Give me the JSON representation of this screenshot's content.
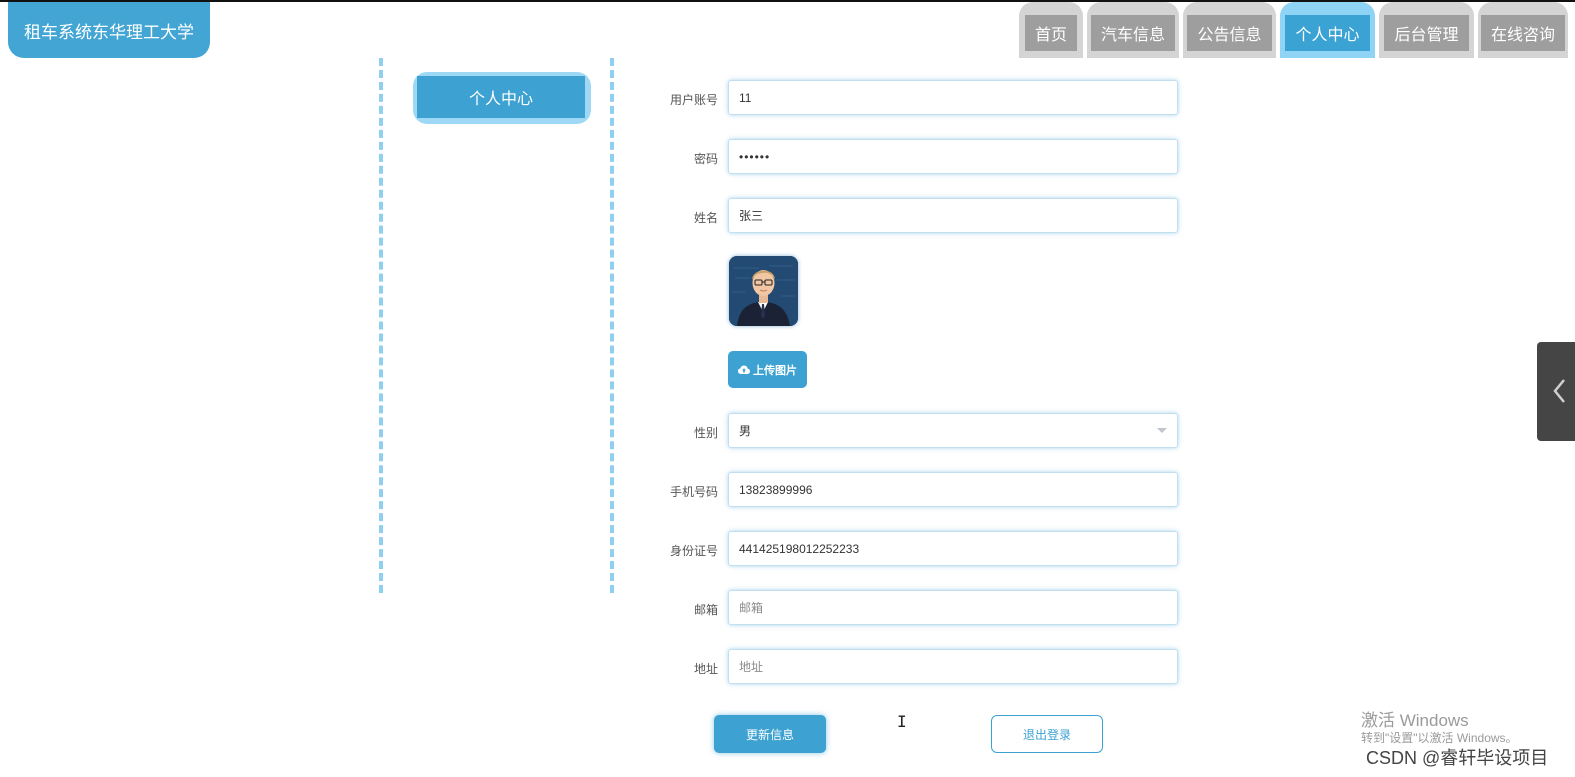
{
  "site": {
    "title": "租车系统东华理工大学"
  },
  "nav": {
    "items": [
      {
        "label": "首页",
        "active": false
      },
      {
        "label": "汽车信息",
        "active": false
      },
      {
        "label": "公告信息",
        "active": false
      },
      {
        "label": "个人中心",
        "active": true
      },
      {
        "label": "后台管理",
        "active": false
      },
      {
        "label": "在线咨询",
        "active": false
      }
    ]
  },
  "sidebar": {
    "title": "个人中心"
  },
  "form": {
    "username": {
      "label": "用户账号",
      "value": "11"
    },
    "password": {
      "label": "密码",
      "value": "••••••"
    },
    "name": {
      "label": "姓名",
      "value": "张三"
    },
    "avatar": {
      "icon": "user-avatar-icon"
    },
    "upload": {
      "label": "上传图片",
      "icon": "cloud-upload-icon"
    },
    "gender": {
      "label": "性别",
      "value": "男"
    },
    "phone": {
      "label": "手机号码",
      "value": "13823899996"
    },
    "idcard": {
      "label": "身份证号",
      "value": "441425198012252233"
    },
    "email": {
      "label": "邮箱",
      "placeholder": "邮箱"
    },
    "address": {
      "label": "地址",
      "placeholder": "地址"
    }
  },
  "actions": {
    "update": "更新信息",
    "logout": "退出登录"
  },
  "watermark": {
    "line1": "激活 Windows",
    "line2": "转到\"设置\"以激活 Windows。",
    "csdn": "CSDN @睿轩毕设项目"
  },
  "colors": {
    "primary": "#3da2d2",
    "nav_idle": "#9e9e9e",
    "dash": "#8fd0f0"
  }
}
